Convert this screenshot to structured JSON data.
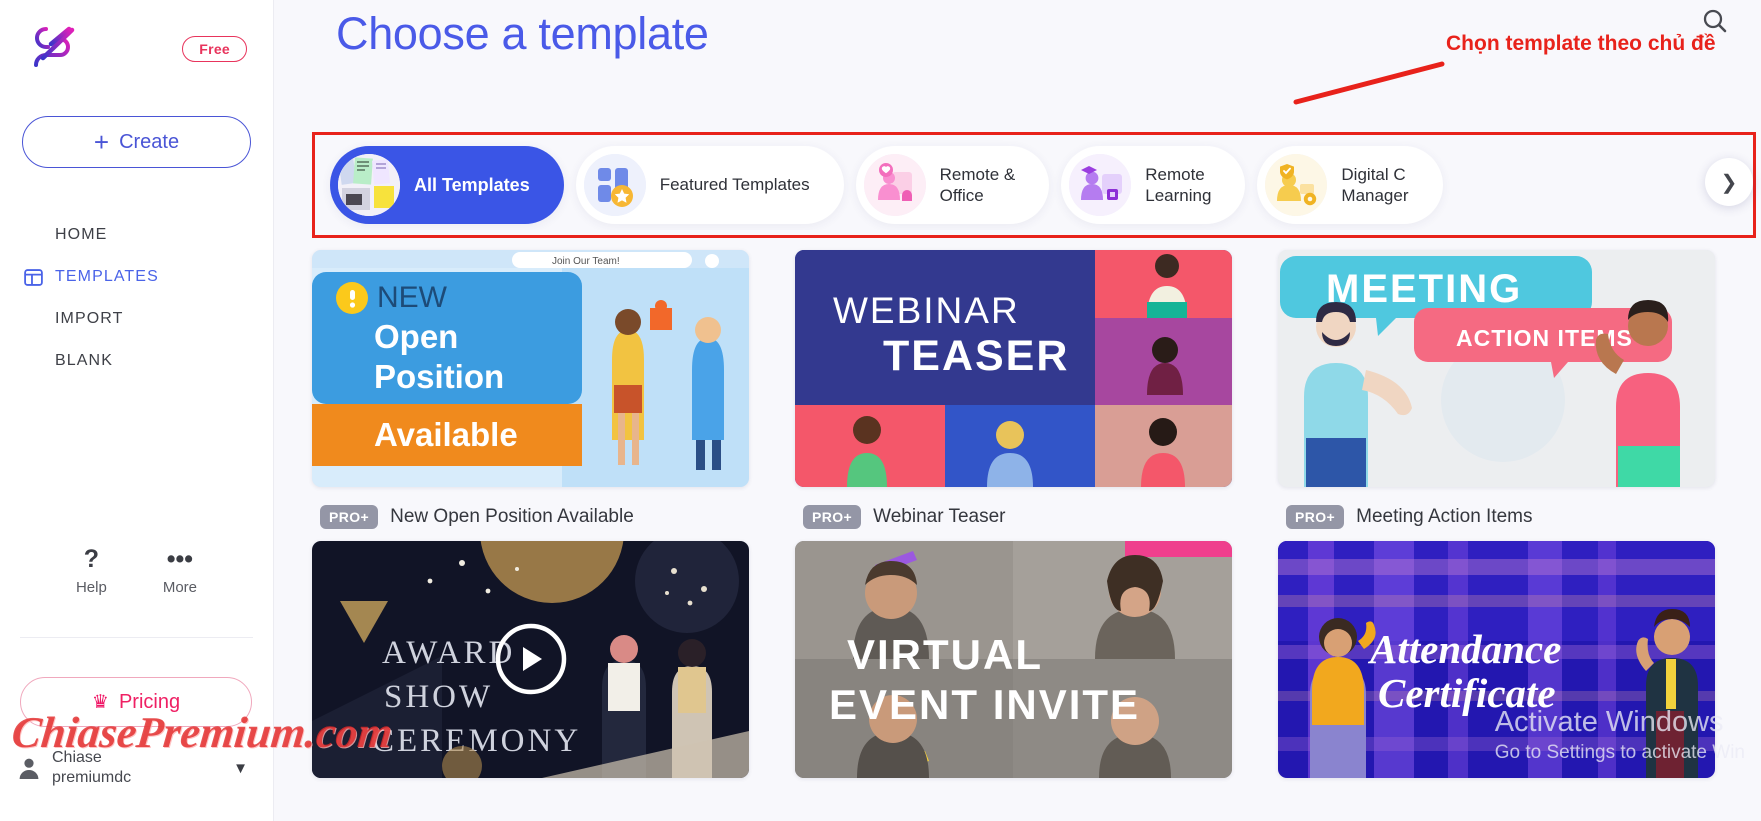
{
  "sidebar": {
    "logo_icon": "offeo-logo-icon",
    "plan_badge": "Free",
    "create_label": "Create",
    "nav": [
      {
        "label": "HOME",
        "icon": "home-icon",
        "active": false
      },
      {
        "label": "TEMPLATES",
        "icon": "templates-grid-icon",
        "active": true
      },
      {
        "label": "IMPORT",
        "icon": "import-icon",
        "active": false
      },
      {
        "label": "BLANK",
        "icon": "blank-icon",
        "active": false
      }
    ],
    "utilities": [
      {
        "label": "Help",
        "icon": "question-mark-icon",
        "glyph": "?"
      },
      {
        "label": "More",
        "icon": "ellipsis-icon",
        "glyph": "•••"
      }
    ],
    "pricing_label": "Pricing",
    "pricing_icon": "crown-icon",
    "account": {
      "line1": "Chiase",
      "line2": "premiumdc",
      "avatar_icon": "user-avatar-icon",
      "chevron_icon": "chevron-down-icon"
    }
  },
  "header": {
    "title": "Choose a template",
    "search_icon": "search-icon"
  },
  "annotation": {
    "text": "Chọn template theo chủ đề",
    "color": "#e8221b",
    "highlight_box_color": "#e8221b",
    "arrow_icon": "arrow-line-icon"
  },
  "categories": {
    "next_icon": "chevron-right-icon",
    "items": [
      {
        "label": "All Templates",
        "icon": "templates-collage-icon",
        "selected": true
      },
      {
        "label": "Featured Templates",
        "icon": "featured-star-icon",
        "selected": false
      },
      {
        "label": "Remote &\nOffice",
        "icon": "remote-office-icon",
        "selected": false
      },
      {
        "label": "Remote\nLearning",
        "icon": "remote-learning-icon",
        "selected": false
      },
      {
        "label": "Digital C\nManager",
        "icon": "digital-change-management-icon",
        "selected": false
      }
    ]
  },
  "templates": {
    "rows": [
      [
        {
          "title": "New Open Position Available",
          "badge": "PRO+",
          "thumb_icon": "new-open-position-thumbnail",
          "thumb_text": {
            "tag": "Join Our Team!",
            "l1": "NEW",
            "l2": "Open",
            "l3": "Position",
            "l4": "Available"
          }
        },
        {
          "title": "Webinar Teaser",
          "badge": "PRO+",
          "thumb_icon": "webinar-teaser-thumbnail",
          "thumb_text": {
            "l1": "WEBINAR",
            "l2": "TEASER"
          }
        },
        {
          "title": "Meeting Action Items",
          "badge": "PRO+",
          "thumb_icon": "meeting-action-items-thumbnail",
          "thumb_text": {
            "l1": "MEETING",
            "l2": "ACTION ITEMS"
          }
        }
      ],
      [
        {
          "title": "",
          "badge": "",
          "thumb_icon": "award-show-ceremony-thumbnail",
          "thumb_text": {
            "l1": "AWARD",
            "l2": "SHOW",
            "l3": "CEREMONY"
          },
          "play_icon": "play-button-icon"
        },
        {
          "title": "",
          "badge": "",
          "thumb_icon": "virtual-event-invite-thumbnail",
          "thumb_text": {
            "l1": "VIRTUAL",
            "l2": "EVENT INVITE"
          }
        },
        {
          "title": "",
          "badge": "",
          "thumb_icon": "attendance-certificate-thumbnail",
          "thumb_text": {
            "l1": "Attendance",
            "l2": "Certificate"
          }
        }
      ]
    ]
  },
  "overlays": {
    "watermark": "ChiasePremium.com",
    "windows_activation_line1": "Activate Windows",
    "windows_activation_line2": "Go to Settings to activate Win"
  }
}
